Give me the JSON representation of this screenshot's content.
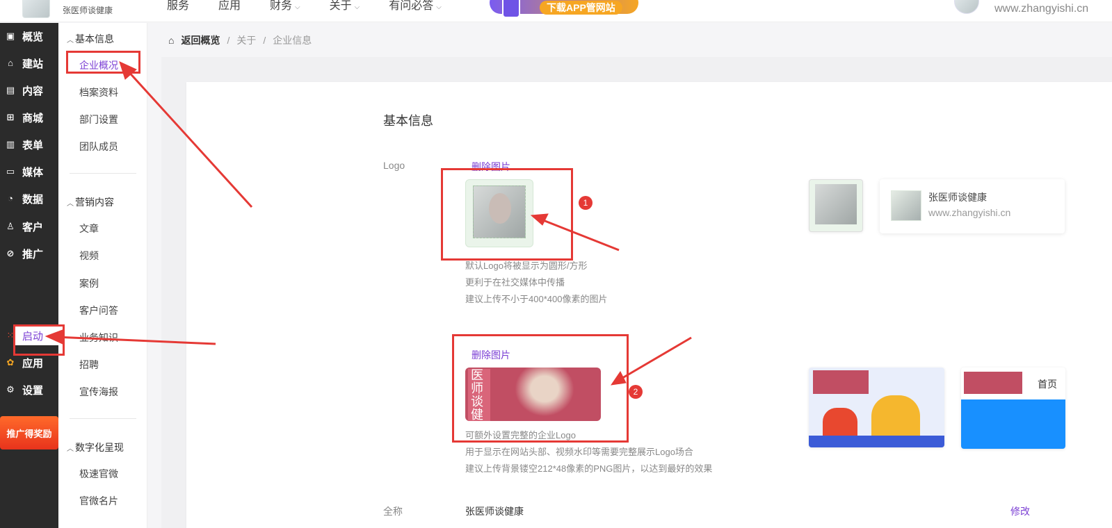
{
  "topbar": {
    "brand_name": "张医师谈健康",
    "nav": [
      "服务",
      "应用",
      "财务",
      "关于",
      "有问必答"
    ],
    "nav_has_dropdown": [
      false,
      false,
      true,
      true,
      true
    ],
    "banner_label": "下载APP管网站",
    "domain": "www.zhangyishi.cn"
  },
  "sidebar": {
    "items": [
      {
        "label": "概览",
        "icon": "overview-icon"
      },
      {
        "label": "建站",
        "icon": "home-icon"
      },
      {
        "label": "内容",
        "icon": "document-icon"
      },
      {
        "label": "商城",
        "icon": "cart-icon"
      },
      {
        "label": "表单",
        "icon": "form-icon"
      },
      {
        "label": "媒体",
        "icon": "video-icon"
      },
      {
        "label": "数据",
        "icon": "chart-icon"
      },
      {
        "label": "客户",
        "icon": "user-icon"
      },
      {
        "label": "推广",
        "icon": "paperclip-icon"
      }
    ],
    "bottom_items": [
      {
        "label": "启动",
        "icon": "dots-icon"
      },
      {
        "label": "应用",
        "icon": "apps-icon"
      },
      {
        "label": "设置",
        "icon": "gear-icon"
      }
    ],
    "promo_label": "推广得奖励"
  },
  "subnav": {
    "groups": [
      {
        "title": "基本信息",
        "items": [
          "企业概况",
          "档案资料",
          "部门设置",
          "团队成员"
        ]
      },
      {
        "title": "营销内容",
        "items": [
          "文章",
          "视频",
          "案例",
          "客户问答",
          "业务知识",
          "招聘",
          "宣传海报"
        ]
      },
      {
        "title": "数字化呈现",
        "items": [
          "极速官微",
          "官微名片"
        ]
      }
    ]
  },
  "breadcrumb": {
    "back": "返回概览",
    "sep": "/",
    "level1": "关于",
    "level2": "企业信息"
  },
  "main": {
    "section_title": "基本信息",
    "logo_label": "Logo",
    "delete_image": "删除图片",
    "logo_hints": [
      "默认Logo将被显示为圆形/方形",
      "更利于在社交媒体中传播",
      "建议上传不小于400*400像素的图片"
    ],
    "wide_logo_text": "医师谈健",
    "wide_hints": [
      "可额外设置完整的企业Logo",
      "用于显示在网站头部、视频水印等需要完整展示Logo场合",
      "建议上传背景镂空212*48像素的PNG图片，以达到最好的效果"
    ],
    "preview_name": "张医师谈健康",
    "preview_url": "www.zhangyishi.cn",
    "mobile_home": "首页",
    "fullname_label": "全称",
    "fullname_value": "张医师谈健康",
    "edit_label": "修改"
  },
  "annotations": {
    "badge1": "1",
    "badge2": "2"
  },
  "colors": {
    "accent": "#7b3fd4",
    "sidebar_bg": "#2b2b2b",
    "annotation_red": "#e53935",
    "logo_bg": "#c14e63"
  }
}
